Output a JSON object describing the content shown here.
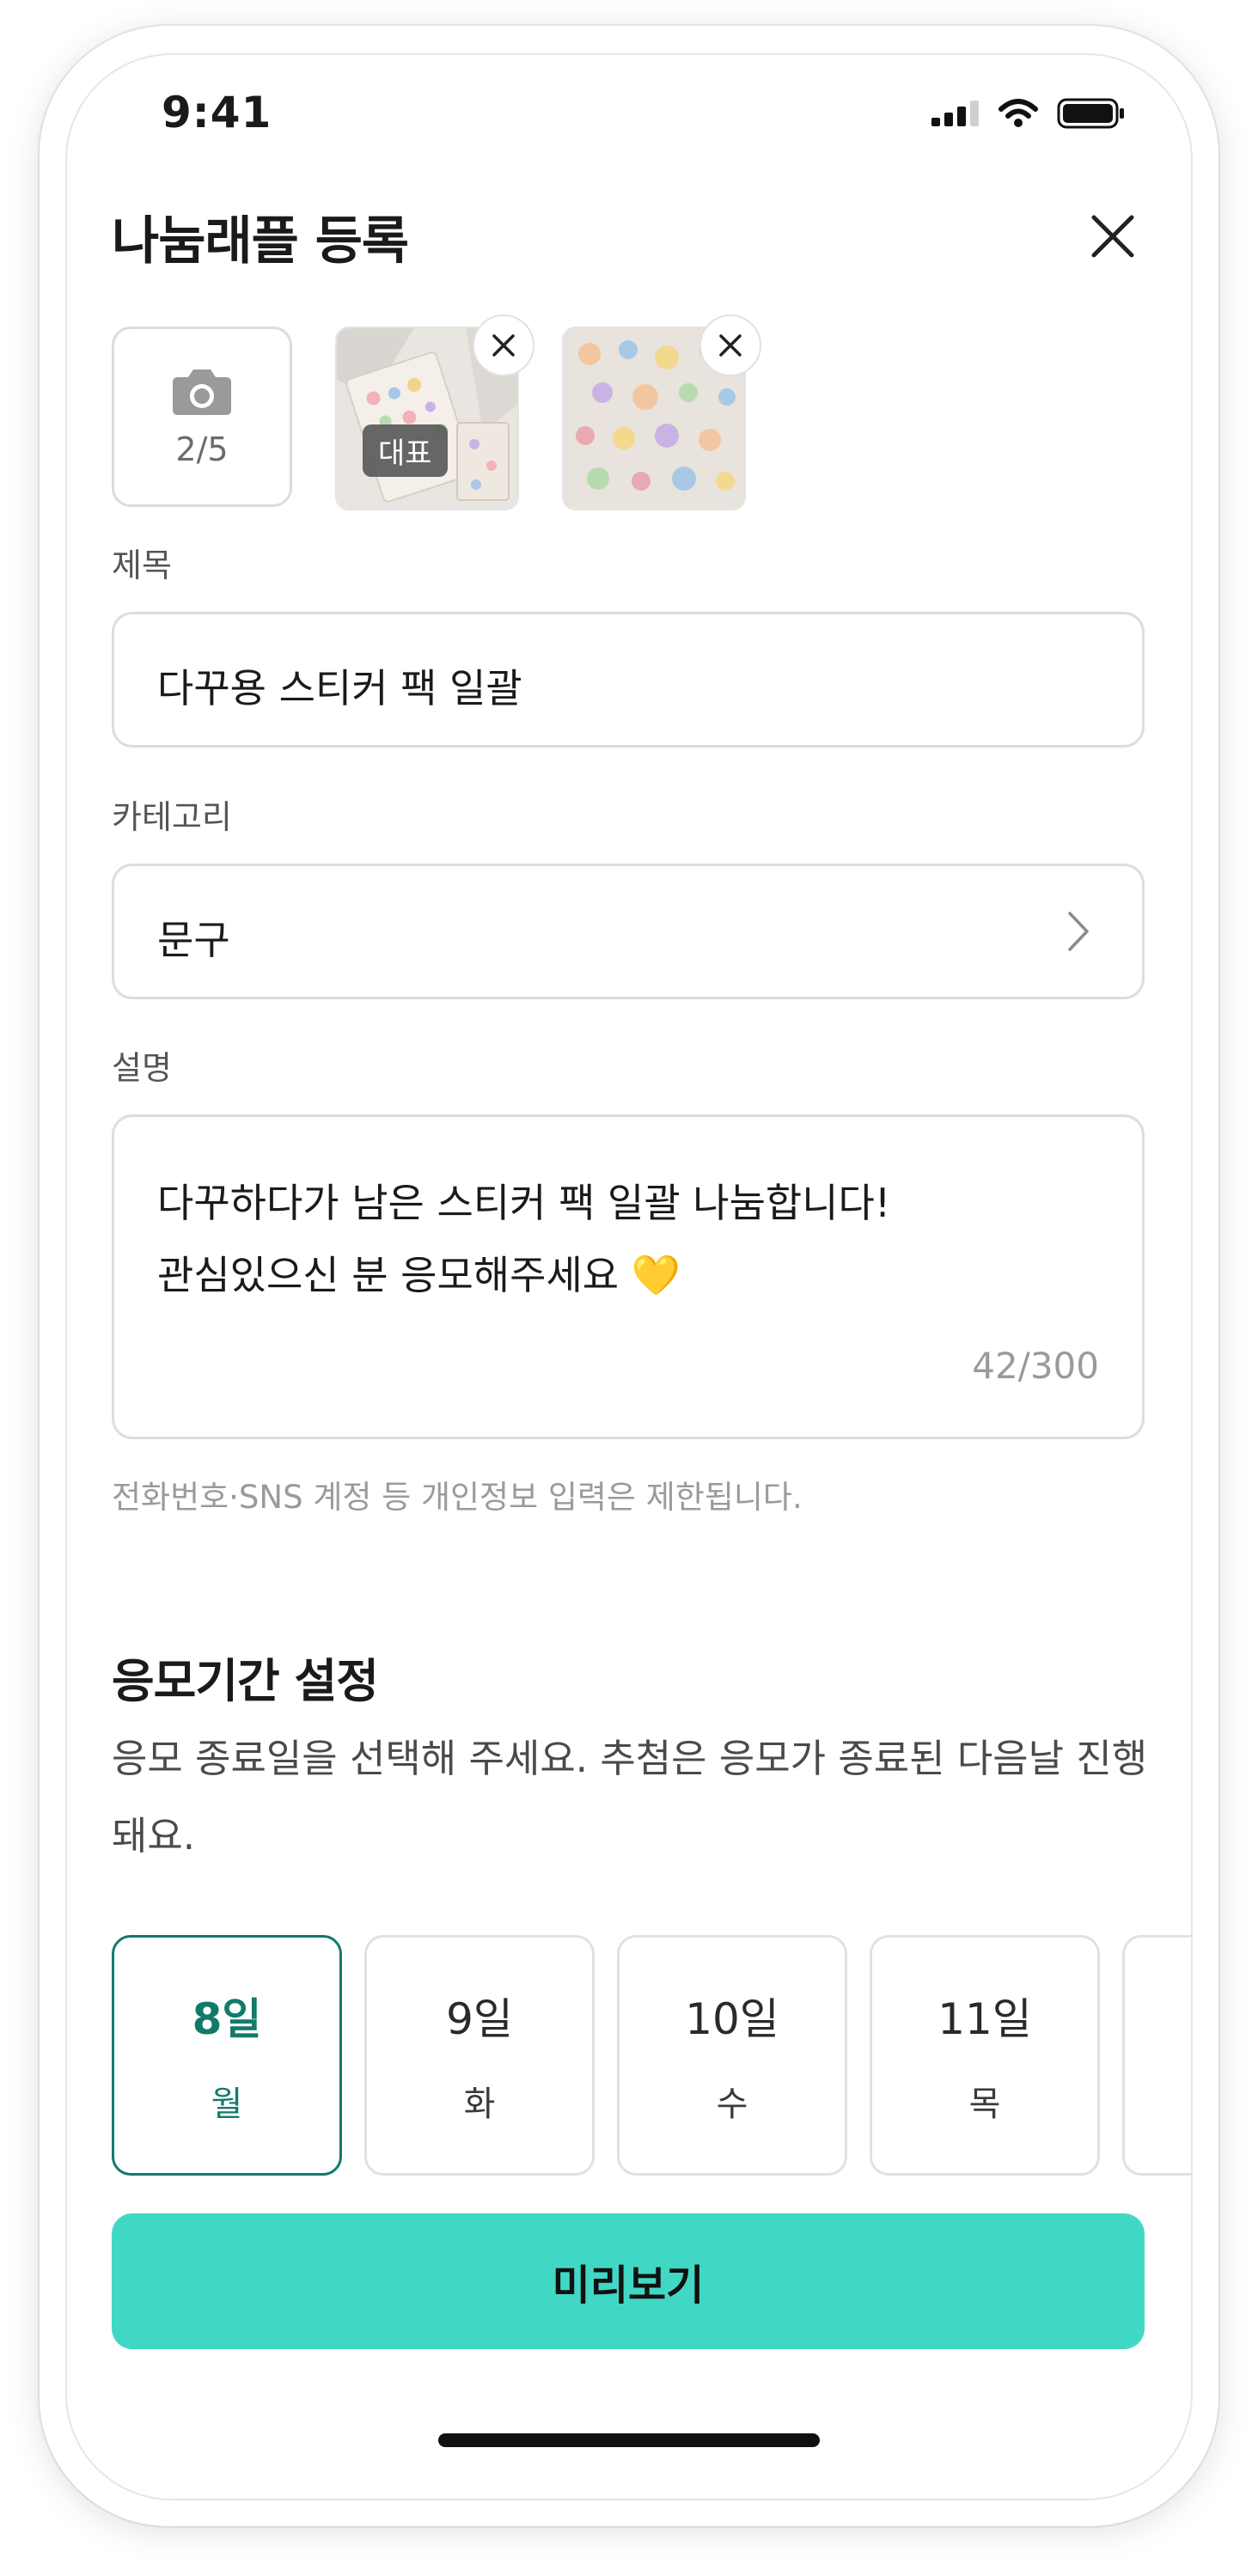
{
  "status_bar": {
    "time": "9:41"
  },
  "header": {
    "title": "나눔래플 등록"
  },
  "photos": {
    "count_label": "2/5",
    "representative_label": "대표"
  },
  "title_field": {
    "label": "제목",
    "value": "다꾸용 스티커 팩 일괄"
  },
  "category_field": {
    "label": "카테고리",
    "value": "문구"
  },
  "description_field": {
    "label": "설명",
    "line1": "다꾸하다가 남은 스티커 팩 일괄 나눔합니다!",
    "line2": "관심있으신 분 응모해주세요 💛",
    "char_count": "42/300"
  },
  "notice": "전화번호·SNS 계정 등 개인정보 입력은 제한됩니다.",
  "entry_period": {
    "title": "응모기간 설정",
    "description": "응모 종료일을 선택해 주세요. 추첨은 응모가 종료된 다음날 진행돼요.",
    "dates": [
      {
        "day": "8일",
        "weekday": "월",
        "selected": true
      },
      {
        "day": "9일",
        "weekday": "화",
        "selected": false
      },
      {
        "day": "10일",
        "weekday": "수",
        "selected": false
      },
      {
        "day": "11일",
        "weekday": "목",
        "selected": false
      }
    ]
  },
  "preview_button": "미리보기",
  "colors": {
    "accent": "#40d8c4",
    "selected": "#127a6a"
  }
}
